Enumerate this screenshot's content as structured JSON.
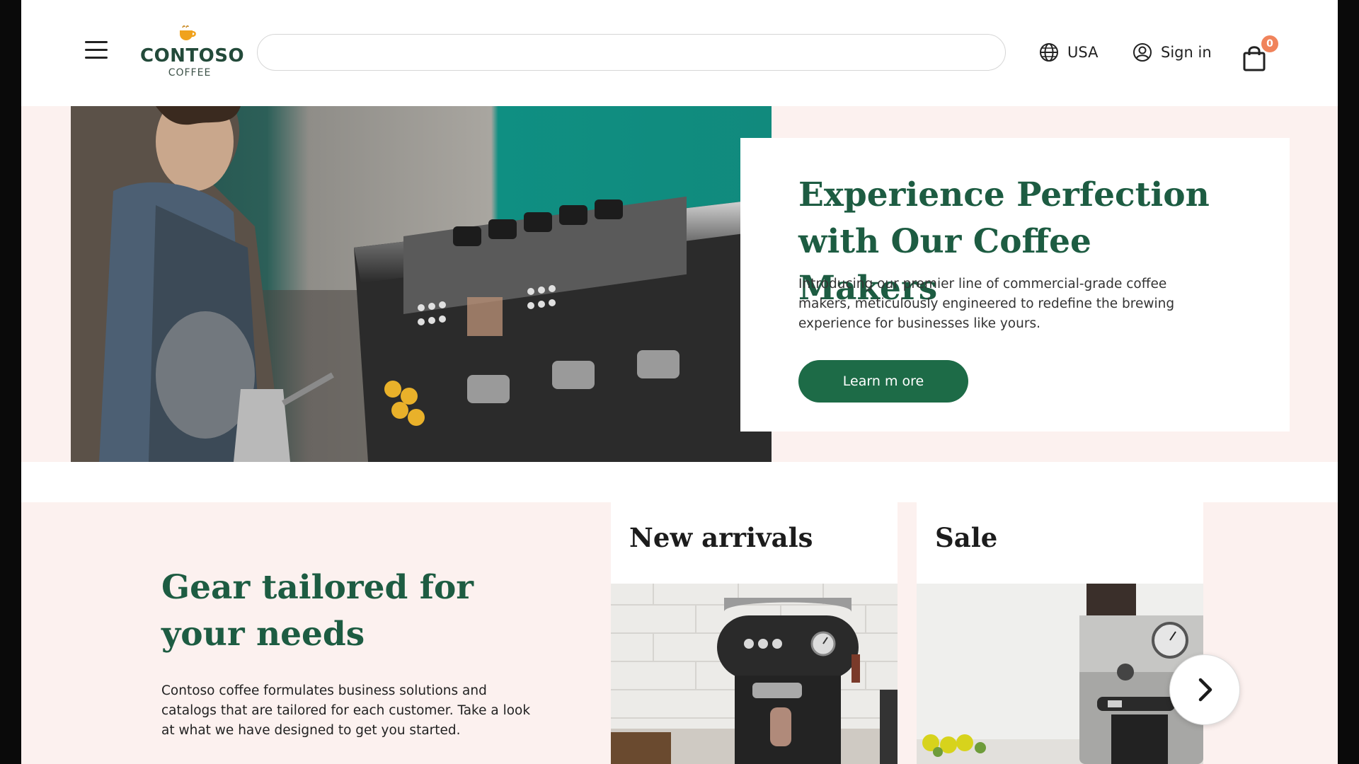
{
  "brand": {
    "name": "CONTOSO",
    "sub": "COFFEE"
  },
  "header": {
    "search": {
      "placeholder": "",
      "value": ""
    },
    "region_label": "USA",
    "signin_label": "Sign in",
    "cart_count": "0"
  },
  "hero": {
    "title": "Experience Perfection with Our Coffee Makers",
    "body": "Introducing our premier line of commercial-grade coffee makers, meticulously engineered to redefine the brewing experience for businesses like yours.",
    "cta_label": "Learn m ore"
  },
  "gear": {
    "title": "Gear tailored for your needs",
    "body": "Contoso coffee formulates business solutions and catalogs that are tailored for each customer. Take a look at what we have designed to get you started."
  },
  "cards": [
    {
      "title": "New arrivals"
    },
    {
      "title": "Sale"
    }
  ],
  "icons": {
    "menu": "hamburger-menu-icon",
    "region": "globe-icon",
    "signin": "user-circle-icon",
    "cart": "shopping-bag-icon",
    "next": "chevron-right-icon"
  },
  "colors": {
    "brand_green": "#1d5c42",
    "button_green": "#1d6b47",
    "section_bg": "#fcf1ef",
    "badge": "#f0835b"
  }
}
